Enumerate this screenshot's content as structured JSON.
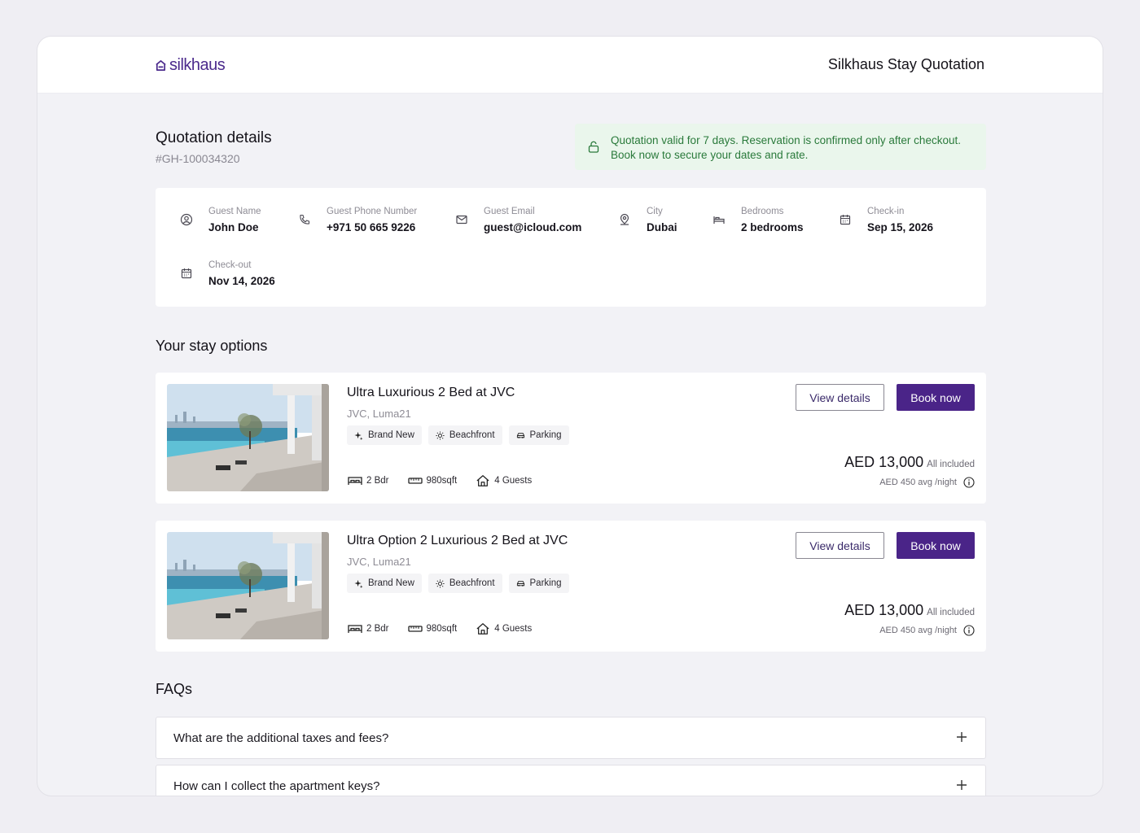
{
  "header": {
    "logo_text": "silkhaus",
    "title": "Silkhaus Stay Quotation"
  },
  "quotation": {
    "title": "Quotation details",
    "id": "#GH-100034320",
    "notice_line1": "Quotation valid for 7 days. Reservation is confirmed only after checkout.",
    "notice_line2": "Book now to secure your dates and rate."
  },
  "guest": {
    "fields": [
      {
        "label": "Guest Name",
        "value": "John Doe",
        "icon": "user-icon"
      },
      {
        "label": "Guest Phone Number",
        "value": "+971 50 665 9226",
        "icon": "phone-icon"
      },
      {
        "label": "Guest Email",
        "value": "guest@icloud.com",
        "icon": "mail-icon"
      },
      {
        "label": "City",
        "value": "Dubai",
        "icon": "map-pin-icon"
      },
      {
        "label": "Bedrooms",
        "value": "2 bedrooms",
        "icon": "bed-icon"
      },
      {
        "label": "Check-in",
        "value": "Sep 15, 2026",
        "icon": "calendar-icon"
      },
      {
        "label": "Check-out",
        "value": "Nov 14, 2026",
        "icon": "calendar-icon"
      }
    ]
  },
  "stay_options": {
    "title": "Your stay options",
    "listings": [
      {
        "title": "Ultra Luxurious 2 Bed at JVC",
        "location": "JVC, Luma21",
        "tags": [
          "Brand New",
          "Beachfront",
          "Parking"
        ],
        "beds": "2 Bdr",
        "size": "980sqft",
        "guests": "4 Guests",
        "view_label": "View details",
        "book_label": "Book now",
        "price": "AED 13,000",
        "price_note": "All included",
        "avg": "AED 450 avg /night"
      },
      {
        "title": "Ultra Option 2 Luxurious 2 Bed at JVC",
        "location": "JVC, Luma21",
        "tags": [
          "Brand New",
          "Beachfront",
          "Parking"
        ],
        "beds": "2 Bdr",
        "size": "980sqft",
        "guests": "4 Guests",
        "view_label": "View details",
        "book_label": "Book now",
        "price": "AED 13,000",
        "price_note": "All included",
        "avg": "AED 450 avg /night"
      }
    ]
  },
  "faqs": {
    "title": "FAQs",
    "items": [
      "What are the additional taxes and fees?",
      "How can I collect the apartment keys?"
    ]
  },
  "colors": {
    "brand": "#4a2488",
    "notice_bg": "#eaf6ec",
    "notice_text": "#2a7a3b"
  }
}
